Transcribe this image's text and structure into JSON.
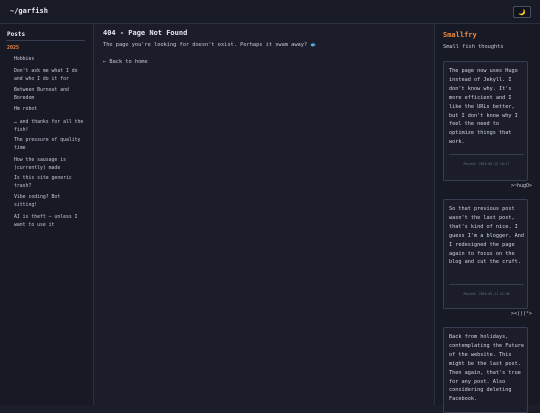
{
  "header": {
    "site_title": "~/garfish",
    "theme_toggle_icon": "moon-icon",
    "theme_toggle_glyph": "🌙"
  },
  "sidebar": {
    "heading": "Posts",
    "year": "2025",
    "posts": [
      "Hobbies",
      "Don't ask me what I do and who I do it for",
      "Between Burnout and Boredom",
      "Hm robot",
      "… and thanks for all the fish!",
      "The pressure of quality time",
      "How the sausage is (currently) made",
      "Is this site generic trash?",
      "Vibe coding? Bot sitting!",
      "AI is theft – unless I want to use it"
    ]
  },
  "main": {
    "title": "404 - Page Not Found",
    "message": "The page you're looking for doesn't exist. Perhaps it swam away?",
    "fish_glyph": "🐟",
    "back_link": "← Back to home"
  },
  "right": {
    "title": "Smallfry",
    "subtitle": "Small fish thoughts",
    "cards": [
      {
        "text": "The page now uses Hugo instead of Jekyll. I don't know why. It's more efficient and I like the URLs better, but I don't know why I feel the need to optimize things that work.",
        "posted": "Posted: 2025-05-15 10:17",
        "kaomoji": ">~hugO>"
      },
      {
        "text": "So that previous post wasn't the last post, that's kind of nice. I guess I'm a blogger. And I redesigned the page again to focus on the blog and cut the cruft.",
        "posted": "Posted: 2025-05-11 21:56",
        "kaomoji": "><(((°>"
      },
      {
        "text": "Back from holidays, contemplating the Future of the website. This might be the last post. Then again, that's true for any post. Also considering deleting Facebook.",
        "posted": "",
        "kaomoji": ""
      }
    ]
  }
}
